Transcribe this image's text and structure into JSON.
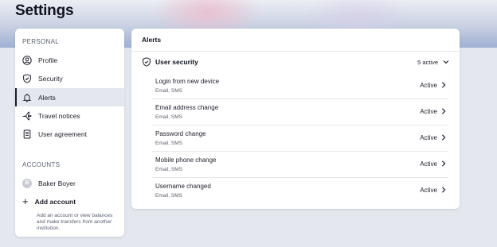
{
  "page": {
    "title": "Settings"
  },
  "sidebar": {
    "personal_label": "PERSONAL",
    "items": [
      {
        "label": "Profile",
        "icon": "user-circle-icon"
      },
      {
        "label": "Security",
        "icon": "shield-icon"
      },
      {
        "label": "Alerts",
        "icon": "bell-icon",
        "active": true
      },
      {
        "label": "Travel notices",
        "icon": "airplane-icon"
      },
      {
        "label": "User agreement",
        "icon": "document-icon"
      }
    ],
    "accounts_label": "ACCOUNTS",
    "account": {
      "name": "Baker Boyer",
      "avatar_letter": "B"
    },
    "add_account": {
      "label": "Add account",
      "description": "Add an account or view balances and make transfers from another institution."
    }
  },
  "main": {
    "title": "Alerts",
    "group": {
      "title": "User security",
      "count": "5 active",
      "rows": [
        {
          "title": "Login from new device",
          "channels": "Email, SMS",
          "status": "Active"
        },
        {
          "title": "Email address change",
          "channels": "Email, SMS",
          "status": "Active"
        },
        {
          "title": "Password change",
          "channels": "Email, SMS",
          "status": "Active"
        },
        {
          "title": "Mobile phone change",
          "channels": "Email, SMS",
          "status": "Active"
        },
        {
          "title": "Username changed",
          "channels": "Email, SMS",
          "status": "Active"
        }
      ]
    }
  },
  "colors": {
    "accent": "#1a1d2b",
    "active_bg": "#e4e7ee",
    "page_bg": "#e4e7ee"
  }
}
